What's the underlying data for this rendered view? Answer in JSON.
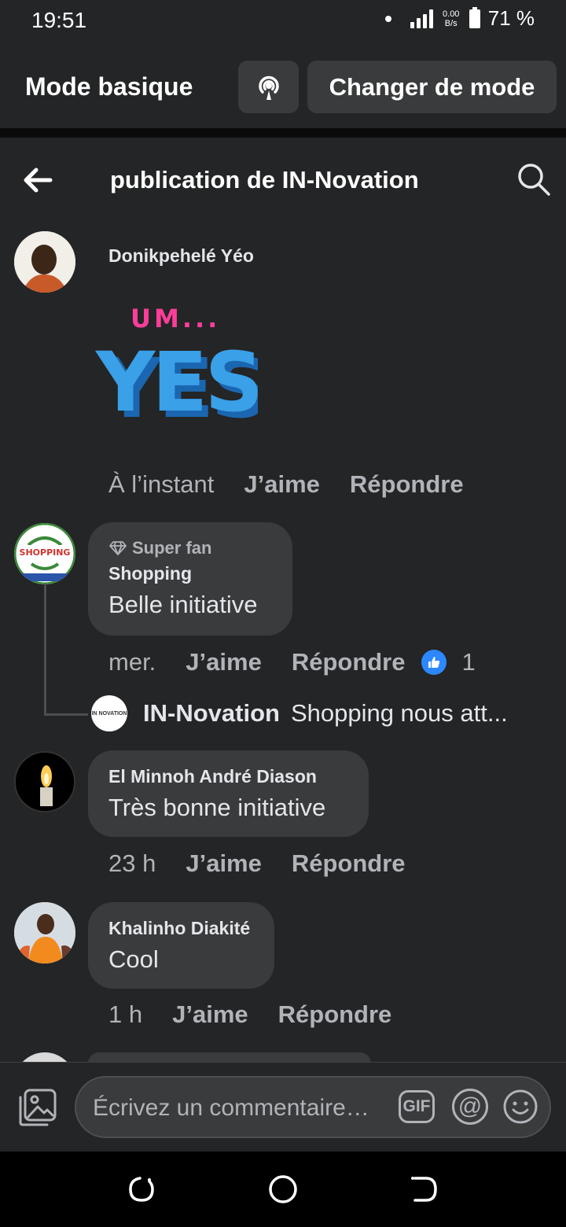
{
  "status_bar": {
    "time": "19:51",
    "speed_value": "0.00",
    "speed_unit": "B/s",
    "battery_percent": "71 %",
    "battery_level": 0.71
  },
  "mode_bar": {
    "title": "Mode basique",
    "change_label": "Changer de mode"
  },
  "header": {
    "title": "publication de IN-Novation"
  },
  "comments": [
    {
      "author": "Donikpehelé Yéo",
      "sticker": {
        "line1": "UM...",
        "line2": "YES"
      },
      "timestamp": "À l’instant",
      "like_label": "J’aime",
      "reply_label": "Répondre"
    },
    {
      "badge": "Super fan",
      "author": "Shopping",
      "avatar_text": "SHOPPING",
      "text": "Belle initiative",
      "timestamp": "mer.",
      "like_label": "J’aime",
      "reply_label": "Répondre",
      "reaction_count": "1",
      "reply": {
        "author": "IN-Novation",
        "avatar_text": "IN NOVATION",
        "text": "Shopping nous att..."
      }
    },
    {
      "author": "El Minnoh André Diason",
      "text": "Très bonne initiative",
      "timestamp": "23 h",
      "like_label": "J’aime",
      "reply_label": "Répondre"
    },
    {
      "author": "Khalinho Diakité",
      "text": "Cool",
      "timestamp": "1 h",
      "like_label": "J’aime",
      "reply_label": "Répondre"
    }
  ],
  "composer": {
    "placeholder": "Écrivez un commentaire…",
    "gif_label": "GIF",
    "at_label": "@"
  },
  "colors": {
    "background": "#242526",
    "bubble": "#3a3b3c",
    "muted_text": "#b0b3b8",
    "like_blue": "#2d88ff",
    "sticker_pink": "#ff3d9a",
    "sticker_blue": "#3aa0e8"
  }
}
